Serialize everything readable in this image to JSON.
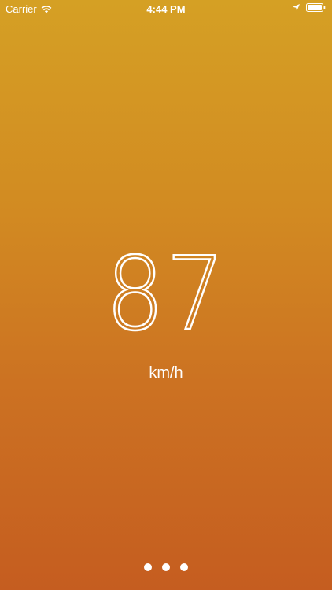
{
  "status_bar": {
    "carrier": "Carrier",
    "time": "4:44 PM",
    "wifi_icon": "wifi-icon",
    "location_icon": "location-arrow-icon",
    "battery_icon": "battery-icon"
  },
  "speed": {
    "value": "87",
    "unit": "km/h"
  },
  "page_indicator": {
    "count": 3,
    "current": 1
  },
  "colors": {
    "gradient_top": "#d5a024",
    "gradient_bottom": "#c55d20",
    "text": "#ffffff"
  }
}
